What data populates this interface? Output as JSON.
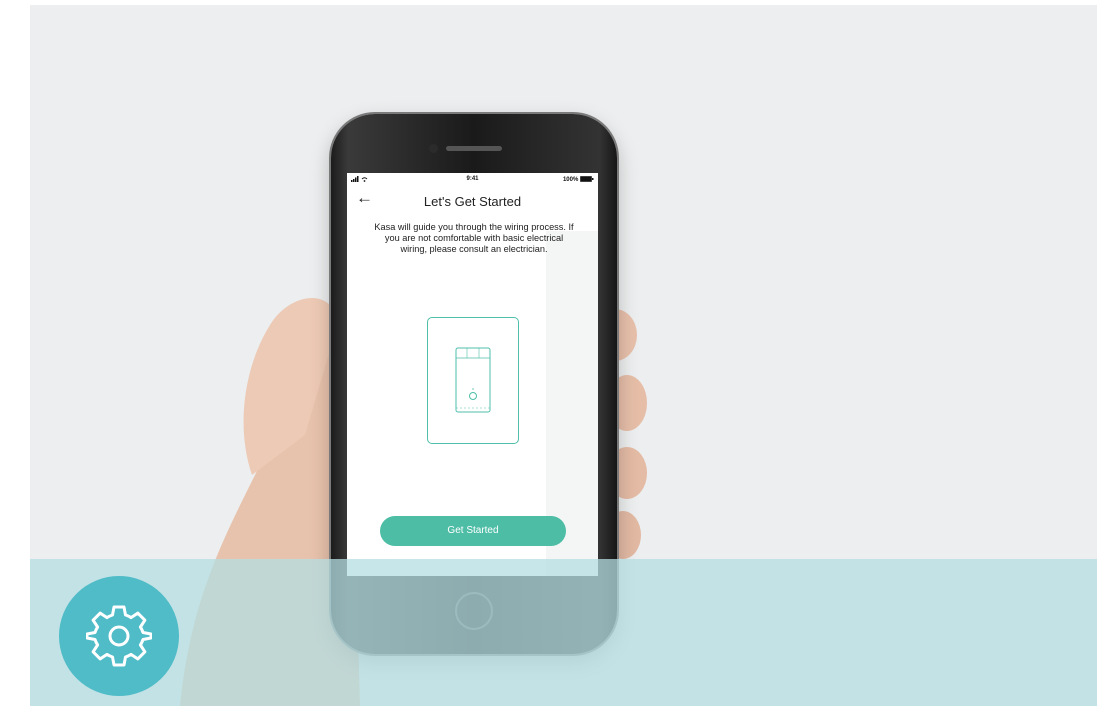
{
  "colors": {
    "background": "#eceeef",
    "accent": "#4dbda5",
    "overlay": "#b4dde1",
    "badge": "#4fbcc8"
  },
  "status_bar": {
    "time": "9:41",
    "battery": "100%"
  },
  "header": {
    "back_icon": "arrow-left-icon",
    "title": "Let's Get Started"
  },
  "body": {
    "description": "Kasa will guide you through the wiring process. If you are not comfortable with basic electrical wiring, please consult an electrician."
  },
  "illustration": "light-switch-icon",
  "primary_button": {
    "label": "Get Started"
  },
  "badge_icon": "gear-icon"
}
